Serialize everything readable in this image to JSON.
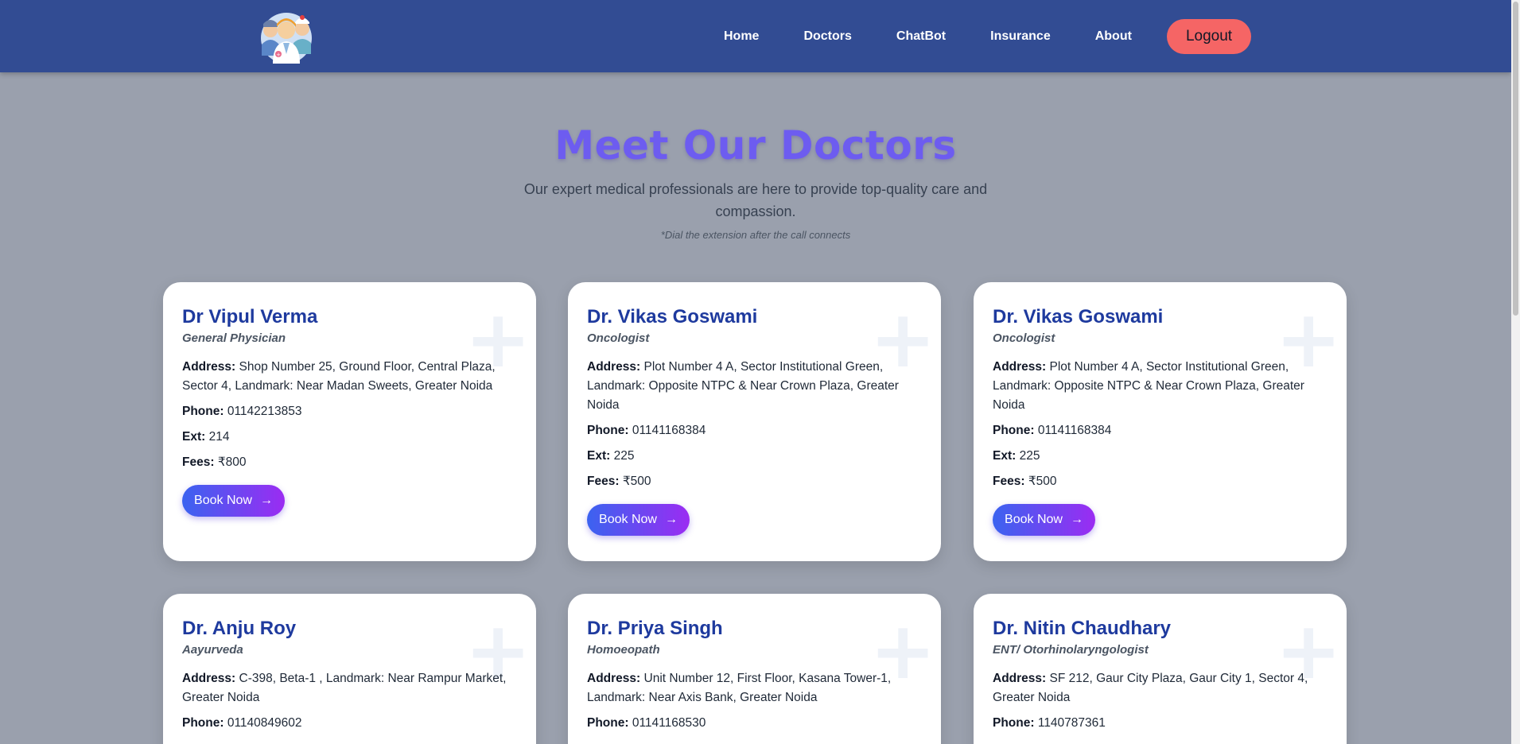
{
  "nav": {
    "links": [
      "Home",
      "Doctors",
      "ChatBot",
      "Insurance",
      "About"
    ],
    "logout": "Logout"
  },
  "hero": {
    "title": "Meet Our Doctors",
    "subtitle": "Our expert medical professionals are here to provide top-quality care and compassion.",
    "note": "*Dial the extension after the call connects"
  },
  "labels": {
    "address": "Address:",
    "phone": "Phone:",
    "ext": "Ext:",
    "fees": "Fees:",
    "book": "Book Now",
    "arrow": "→"
  },
  "doctors": [
    {
      "name": "Dr Vipul Verma",
      "specialty": "General Physician",
      "address": "Shop Number 25, Ground Floor, Central Plaza, Sector 4, Landmark: Near Madan Sweets, Greater Noida",
      "phone": "01142213853",
      "ext": "214",
      "fees": "₹800"
    },
    {
      "name": "Dr. Vikas Goswami",
      "specialty": "Oncologist",
      "address": "Plot Number 4 A, Sector Institutional Green, Landmark: Opposite NTPC & Near Crown Plaza, Greater Noida",
      "phone": "01141168384",
      "ext": "225",
      "fees": "₹500"
    },
    {
      "name": "Dr. Vikas Goswami",
      "specialty": "Oncologist",
      "address": "Plot Number 4 A, Sector Institutional Green, Landmark: Opposite NTPC & Near Crown Plaza, Greater Noida",
      "phone": "01141168384",
      "ext": "225",
      "fees": "₹500"
    },
    {
      "name": "Dr. Anju Roy",
      "specialty": "Aayurveda",
      "address": "C-398, Beta-1 , Landmark: Near Rampur Market, Greater Noida",
      "phone": "01140849602"
    },
    {
      "name": "Dr. Priya Singh",
      "specialty": "Homoeopath",
      "address": "Unit Number 12, First Floor, Kasana Tower-1, Landmark: Near Axis Bank, Greater Noida",
      "phone": "01141168530"
    },
    {
      "name": "Dr. Nitin Chaudhary",
      "specialty": "ENT/ Otorhinolaryngologist",
      "address": "SF 212, Gaur City Plaza, Gaur City 1, Sector 4, Greater Noida",
      "phone": "1140787361"
    }
  ]
}
